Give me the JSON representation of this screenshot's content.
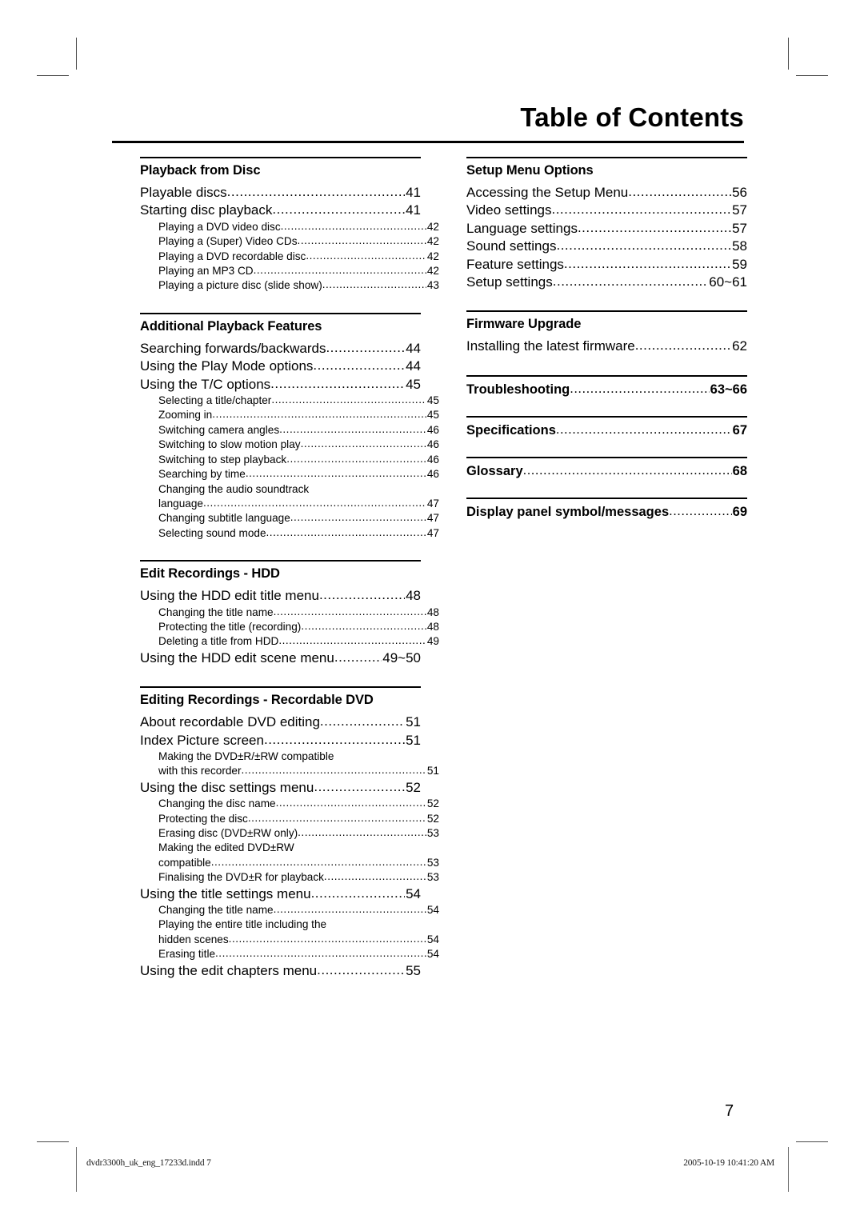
{
  "header": {
    "title": "Table of Contents"
  },
  "left_column": [
    {
      "title": "Playback from Disc",
      "entries": [
        {
          "level": 1,
          "label": "Playable discs",
          "page": "41"
        },
        {
          "level": 1,
          "label": "Starting disc playback",
          "page": "41"
        },
        {
          "level": 2,
          "label": "Playing a DVD video disc",
          "page": "42"
        },
        {
          "level": 2,
          "label": "Playing a (Super) Video CDs",
          "page": "42"
        },
        {
          "level": 2,
          "label": "Playing a DVD recordable disc",
          "page": "42"
        },
        {
          "level": 2,
          "label": "Playing an MP3 CD",
          "page": "42"
        },
        {
          "level": 2,
          "label": "Playing a picture disc (slide show)",
          "page": "43"
        }
      ]
    },
    {
      "title": "Additional Playback Features",
      "entries": [
        {
          "level": 1,
          "label": "Searching forwards/backwards",
          "page": "44"
        },
        {
          "level": 1,
          "label": "Using the Play Mode options",
          "page": "44"
        },
        {
          "level": 1,
          "label": "Using the T/C options",
          "page": "45"
        },
        {
          "level": 2,
          "label": "Selecting a title/chapter",
          "page": "45"
        },
        {
          "level": 2,
          "label": "Zooming in",
          "page": "45"
        },
        {
          "level": 2,
          "label": "Switching camera angles",
          "page": "46"
        },
        {
          "level": 2,
          "label": "Switching to slow motion play",
          "page": "46"
        },
        {
          "level": 2,
          "label": "Switching to step playback",
          "page": "46"
        },
        {
          "level": 2,
          "label": "Searching by time",
          "page": "46"
        },
        {
          "level": 2,
          "wrap_first": "Changing the audio soundtrack",
          "label": "language",
          "page": "47"
        },
        {
          "level": 2,
          "label": "Changing subtitle language",
          "page": "47"
        },
        {
          "level": 2,
          "label": "Selecting sound mode",
          "page": "47"
        }
      ]
    },
    {
      "title": "Edit Recordings - HDD",
      "entries": [
        {
          "level": 1,
          "label": "Using the HDD edit title menu",
          "page": "48"
        },
        {
          "level": 2,
          "label": "Changing the title name",
          "page": " 48"
        },
        {
          "level": 2,
          "label": "Protecting the title (recording)",
          "page": " 48"
        },
        {
          "level": 2,
          "label": "Deleting a title from HDD",
          "page": "49"
        },
        {
          "level": 1,
          "label": "Using the HDD edit scene menu",
          "page": "49~50"
        }
      ]
    },
    {
      "title": "Editing Recordings - Recordable DVD",
      "entries": [
        {
          "level": 1,
          "label": "About recordable DVD editing",
          "page": "51"
        },
        {
          "level": 1,
          "label": "Index Picture screen",
          "page": "51"
        },
        {
          "level": 2,
          "wrap_first": "Making the DVD±R/±RW compatible",
          "label": "with this recorder",
          "page": "51"
        },
        {
          "level": 1,
          "label": "Using the disc settings menu",
          "page": "52"
        },
        {
          "level": 2,
          "label": "Changing the disc name",
          "page": "52"
        },
        {
          "level": 2,
          "label": "Protecting the disc",
          "page": "52"
        },
        {
          "level": 2,
          "label": "Erasing disc (DVD±RW only)",
          "page": "53"
        },
        {
          "level": 2,
          "wrap_first": "Making the edited DVD±RW",
          "label": "compatible",
          "page": "53"
        },
        {
          "level": 2,
          "label": "Finalising the DVD±R for playback",
          "page": "53"
        },
        {
          "level": 1,
          "label": "Using the title settings menu",
          "page": "54"
        },
        {
          "level": 2,
          "label": "Changing the title name",
          "page": "54"
        },
        {
          "level": 2,
          "wrap_first": "Playing the entire title including the",
          "label": "hidden scenes",
          "page": "54"
        },
        {
          "level": 2,
          "label": "Erasing title",
          "page": "54"
        },
        {
          "level": 1,
          "label": "Using the edit chapters menu",
          "page": "55"
        }
      ]
    }
  ],
  "right_column": [
    {
      "title": "Setup Menu Options",
      "entries": [
        {
          "level": 1,
          "label": "Accessing the Setup Menu",
          "page": "56"
        },
        {
          "level": 1,
          "label": "Video settings",
          "page": "57"
        },
        {
          "level": 1,
          "label": "Language settings",
          "page": "57"
        },
        {
          "level": 1,
          "label": "Sound settings",
          "page": "58"
        },
        {
          "level": 1,
          "label": "Feature settings",
          "page": "59"
        },
        {
          "level": 1,
          "label": "Setup settings",
          "page": "60~61"
        }
      ]
    },
    {
      "title": "Firmware Upgrade",
      "entries": [
        {
          "level": 1,
          "label": "Installing the latest firmware",
          "page": "62"
        }
      ]
    },
    {
      "standalone": true,
      "title": "Troubleshooting",
      "page": "63~66"
    },
    {
      "standalone": true,
      "title": "Specifications",
      "page": "67"
    },
    {
      "standalone": true,
      "title": "Glossary",
      "page": "68"
    },
    {
      "standalone": true,
      "title": "Display panel symbol/messages",
      "page": "69"
    }
  ],
  "page_number": "7",
  "footer": {
    "left": "dvdr3300h_uk_eng_17233d.indd   7",
    "right": "2005-10-19   10:41:20 AM"
  }
}
